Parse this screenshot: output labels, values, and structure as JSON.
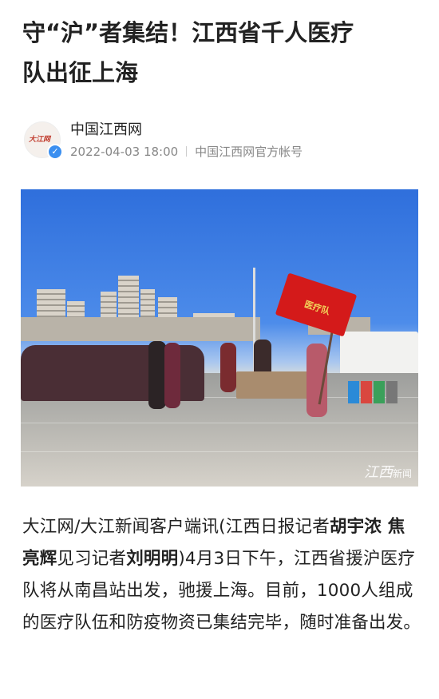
{
  "article": {
    "title_line1": "守“沪”者集结！江西省千人医疗",
    "title_line2": "队出征上海"
  },
  "author": {
    "name": "中国江西网",
    "avatar_text": "大江网",
    "date": "2022-04-03 18:00",
    "account": "中国江西网官方帐号"
  },
  "photo": {
    "flag_text": "医疗队",
    "watermark_main": "江西",
    "watermark_sub": "新闻"
  },
  "body": {
    "p1_a": "大江网/大江新闻客户端讯(江西日报记者",
    "p1_bold1": "胡宇浓 焦亮辉",
    "p1_b": "见习记者",
    "p1_bold2": "刘明明",
    "p1_c": ")4月3日下午，江西省援沪医疗队将从南昌站出发，驰援上海。目前，1000人组成的医疗队伍和防疫物资已集结完毕，随时准备出发。"
  }
}
